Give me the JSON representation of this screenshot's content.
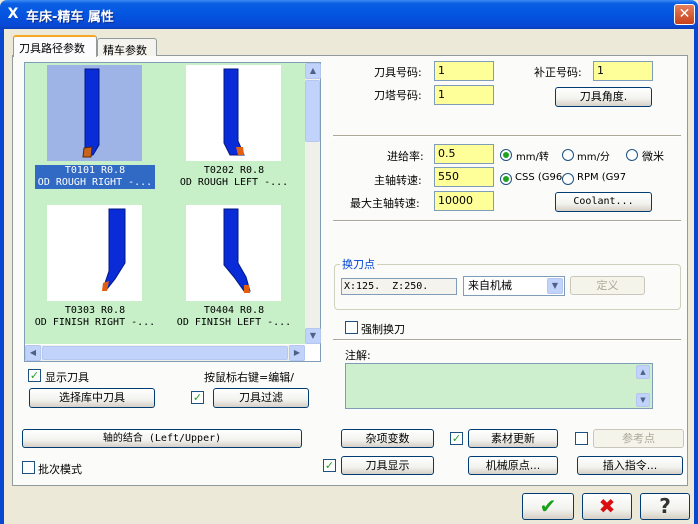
{
  "window": {
    "title": "车床-精车 属性",
    "app_icon": "X",
    "close_glyph": "✕"
  },
  "tabs": [
    {
      "label": "刀具路径参数",
      "active": true
    },
    {
      "label": "精车参数",
      "active": false
    }
  ],
  "tools": [
    {
      "line1": "T0101 R0.8",
      "line2": "OD ROUGH RIGHT -...",
      "selected": true
    },
    {
      "line1": "T0202 R0.8",
      "line2": "OD ROUGH LEFT -..."
    },
    {
      "line1": "T0303 R0.8",
      "line2": "OD FINISH RIGHT -..."
    },
    {
      "line1": "T0404 R0.8",
      "line2": "OD FINISH LEFT -..."
    }
  ],
  "left_panel": {
    "show_tool_label": "显示刀具",
    "show_tool_checked": true,
    "hint": "按鼠标右键=编辑/",
    "select_lib_button": "选择库中刀具",
    "tool_filter_button": "刀具过滤",
    "tool_filter_checked": true
  },
  "fields": {
    "tool_number_label": "刀具号码:",
    "tool_number": "1",
    "offset_number_label": "补正号码:",
    "offset_number": "1",
    "turret_number_label": "刀塔号码:",
    "turret_number": "1",
    "tool_angle_button": "刀具角度.",
    "feed_rate_label": "进给率:",
    "feed_rate": "0.5",
    "spindle_speed_label": "主轴转速:",
    "spindle_speed": "550",
    "max_spindle_label": "最大主轴转速:",
    "max_spindle": "10000",
    "coolant_button": "Coolant..."
  },
  "feed_units": [
    {
      "label": "mm/转",
      "selected": true
    },
    {
      "label": "mm/分",
      "selected": false
    },
    {
      "label": "微米",
      "selected": false
    }
  ],
  "speed_modes": [
    {
      "label": "CSS (G96",
      "selected": true
    },
    {
      "label": "RPM (G97",
      "selected": false
    }
  ],
  "tool_change": {
    "group_label": "换刀点",
    "coords": "X:125.  Z:250.",
    "source": "来自机械",
    "define_button": "定义",
    "force_change_label": "强制换刀",
    "force_change_checked": false
  },
  "comment": {
    "label": "注解:",
    "value": ""
  },
  "bottom": {
    "axis_combo_button": "轴的结合 (Left/Upper)",
    "batch_mode_label": "批次模式",
    "batch_mode_checked": false,
    "misc_values_button": "杂项变数",
    "tool_display_button": "刀具显示",
    "tool_display_checked": true,
    "stock_update_button": "素材更新",
    "stock_update_checked": true,
    "machine_origin_button": "机械原点...",
    "reference_point_button": "参考点",
    "reference_point_checked": false,
    "insert_instruction_button": "插入指令..."
  },
  "dialog_buttons": {
    "ok_icon": "check-icon",
    "cancel_icon": "x-icon",
    "help_icon": "question-icon",
    "ok_glyph": "✔",
    "cancel_glyph": "✖",
    "help_glyph": "?"
  },
  "colors": {
    "title_bar": "#0355e0",
    "tool_area_bg": "#c8f0c8",
    "input_bg": "#ffff99",
    "tool_body": "#0a2bd8",
    "insert": "#e06010"
  }
}
